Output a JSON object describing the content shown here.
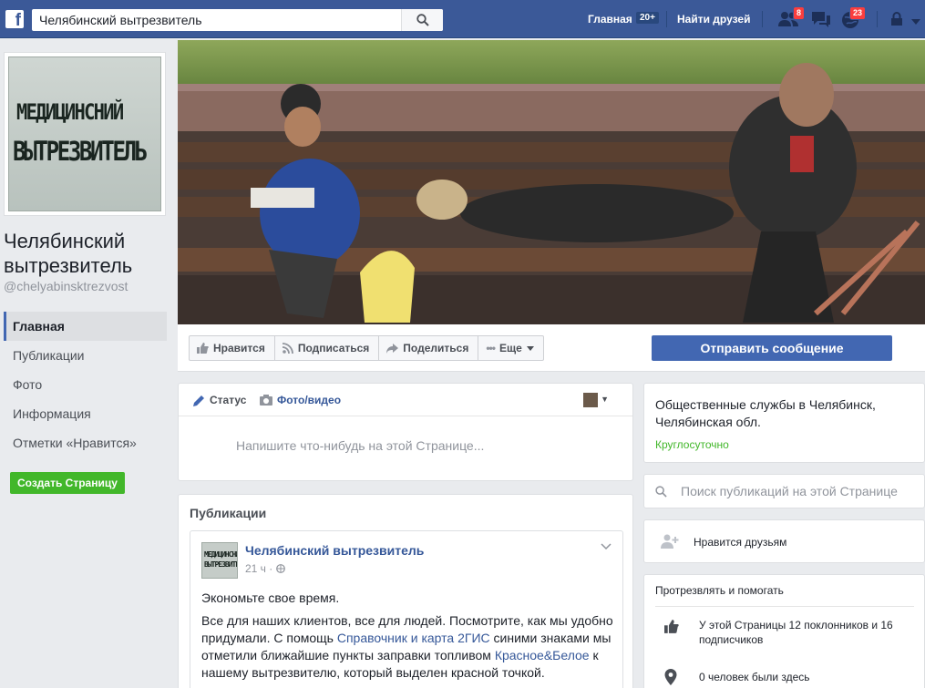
{
  "topbar": {
    "logo": "f",
    "search_value": "Челябинский вытрезвитель",
    "home_label": "Главная",
    "home_count": "20+",
    "find_friends_label": "Найти друзей",
    "friend_requests_badge": "8",
    "notifications_badge": "23",
    "icons": [
      "search-icon",
      "friends-icon",
      "messages-icon",
      "globe-icon",
      "lock-icon",
      "caret-down-icon"
    ]
  },
  "page": {
    "profile_text_line1": "МЕДИЦИНСНИЙ",
    "profile_text_line2": "ВЫТРЕЗВИТЕЛЬ",
    "name": "Челябинский вытрезвитель",
    "handle": "@chelyabinsktrezvost"
  },
  "left_nav": {
    "items": [
      {
        "label": "Главная"
      },
      {
        "label": "Публикации"
      },
      {
        "label": "Фото"
      },
      {
        "label": "Информация"
      },
      {
        "label": "Отметки «Нравится»"
      }
    ],
    "create_page": "Создать Страницу"
  },
  "actions": {
    "like": "Нравится",
    "follow": "Подписаться",
    "share": "Поделиться",
    "more": "Еще",
    "send_message": "Отправить сообщение"
  },
  "composer": {
    "tab_status": "Статус",
    "tab_photo": "Фото/видео",
    "placeholder": "Напишите что-нибудь на этой Странице..."
  },
  "posts": {
    "title": "Публикации",
    "post": {
      "author": "Челябинский вытрезвитель",
      "time": "21 ч ·",
      "avatar_text": "МЕДИЦИНСНИЙ ВЫТРЕЗВИТЕЛЬ",
      "p1": "Экономьте свое время.",
      "p2_a": "Все для наших клиентов, все для людей. Посмотрите, как мы удобно придумали. С помощь ",
      "p2_link1": "Справочник и карта 2ГИС",
      "p2_b": " синими знаками мы отметили ближайшие пункты заправки топливом ",
      "p2_link2": "Красное&Белое",
      "p2_c": " к нашему вытрезвителю, который выделен красной точкой."
    }
  },
  "right": {
    "category": "Общественные службы в Челябинск, Челябинская обл.",
    "hours": "Круглосуточно",
    "search_placeholder": "Поиск публикаций на этой Странице",
    "friends_like": "Нравится друзьям",
    "about_title": "Протрезвлять и помогать",
    "likes_row": "У этой Страницы 12 поклонников и 16 подписчиков",
    "checkins_row": "0 человек были здесь"
  },
  "colors": {
    "brand": "#3b5998",
    "primary_button": "#4267b2",
    "green": "#42b72a",
    "badge": "#fa3e3e"
  }
}
